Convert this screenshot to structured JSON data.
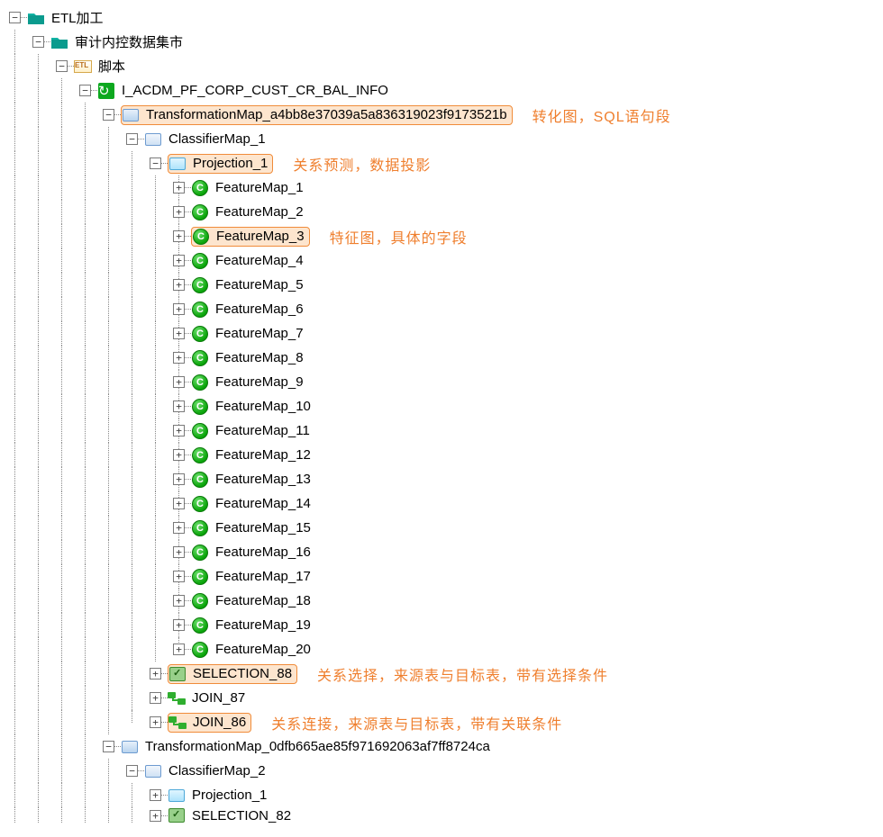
{
  "tree": {
    "root": "ETL加工",
    "l1": "审计内控数据集市",
    "l2": "脚本",
    "l3": "I_ACDM_PF_CORP_CUST_CR_BAL_INFO",
    "tmap1": "TransformationMap_a4bb8e37039a5a836319023f9173521b",
    "cmap1": "ClassifierMap_1",
    "proj1": "Projection_1",
    "features": [
      "FeatureMap_1",
      "FeatureMap_2",
      "FeatureMap_3",
      "FeatureMap_4",
      "FeatureMap_5",
      "FeatureMap_6",
      "FeatureMap_7",
      "FeatureMap_8",
      "FeatureMap_9",
      "FeatureMap_10",
      "FeatureMap_11",
      "FeatureMap_12",
      "FeatureMap_13",
      "FeatureMap_14",
      "FeatureMap_15",
      "FeatureMap_16",
      "FeatureMap_17",
      "FeatureMap_18",
      "FeatureMap_19",
      "FeatureMap_20"
    ],
    "sel88": "SELECTION_88",
    "join87": "JOIN_87",
    "join86": "JOIN_86",
    "tmap2": "TransformationMap_0dfb665ae85f971692063af7ff8724ca",
    "cmap2": "ClassifierMap_2",
    "proj2": "Projection_1",
    "sel82": "SELECTION_82"
  },
  "annotations": {
    "tmap": "转化图，SQL语句段",
    "proj": "关系预测，数据投影",
    "feat": "特征图，具体的字段",
    "sel": "关系选择，来源表与目标表，带有选择条件",
    "join": "关系连接，来源表与目标表，带有关联条件"
  },
  "glyphs": {
    "plus": "+",
    "minus": "−"
  }
}
